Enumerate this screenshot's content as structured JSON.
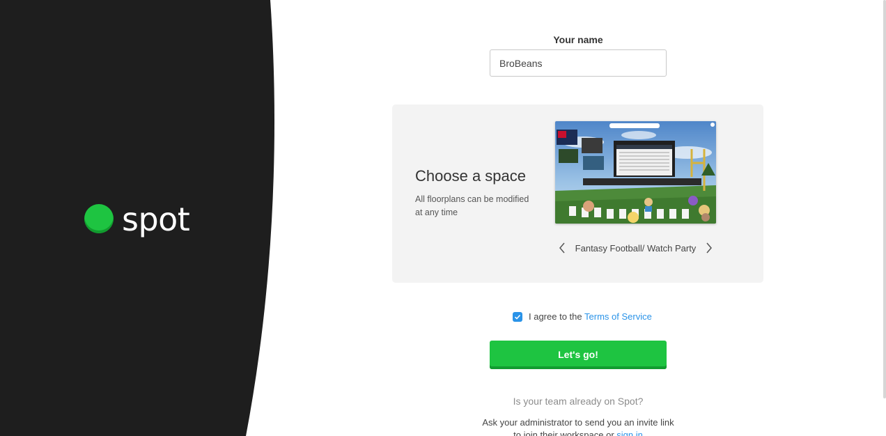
{
  "brand": {
    "name": "spot",
    "accent_color": "#1ec441",
    "panel_color": "#1e1e1e"
  },
  "form": {
    "name_label": "Your name",
    "name_value": "BroBeans"
  },
  "space_card": {
    "title": "Choose a space",
    "description": "All floorplans can be modified at any time",
    "selected_space": "Fantasy Football/ Watch Party",
    "prev_icon": "chevron-left-icon",
    "next_icon": "chevron-right-icon"
  },
  "agreement": {
    "checked": true,
    "prefix": "I agree to the",
    "link_text": "Terms of Service",
    "link_color": "#2a93e8"
  },
  "submit": {
    "label": "Let's go!",
    "color": "#1ec441"
  },
  "footer": {
    "question": "Is your team already on Spot?",
    "instruction_line1": "Ask your administrator to send you an invite link",
    "instruction_line2": "to join their workspace or",
    "signin_text": "sign in"
  }
}
